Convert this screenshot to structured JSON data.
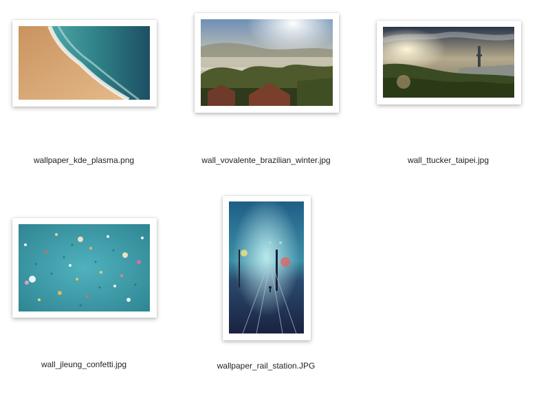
{
  "files": [
    {
      "name": "wallpaper_kde_plasma.png",
      "kind": "beach-waves-image"
    },
    {
      "name": "wall_vovalente_brazilian_winter.jpg",
      "kind": "misty-valley-sunrise-image"
    },
    {
      "name": "wall_ttucker_taipei.jpg",
      "kind": "taipei-skyline-sunset-image"
    },
    {
      "name": "wall_jleung_confetti.jpg",
      "kind": "teal-confetti-image"
    },
    {
      "name": "wallpaper_rail_station.JPG",
      "kind": "night-rail-station-image"
    }
  ]
}
